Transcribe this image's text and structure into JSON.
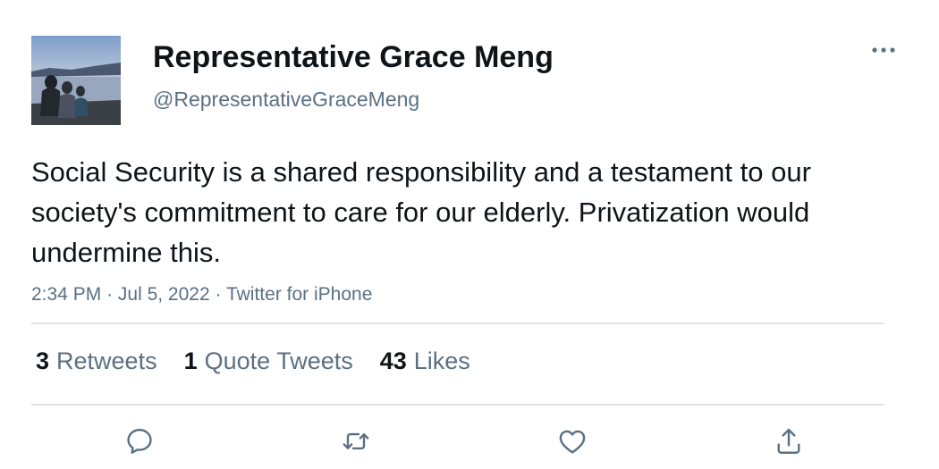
{
  "author": {
    "name": "Representative Grace Meng",
    "handle": "@RepresentativeGraceMeng"
  },
  "tweet": {
    "text": "Social Security is a shared responsibility and a testament to our society's commitment to care for our elderly. Privatization would undermine this.",
    "time": "2:34 PM",
    "date": "Jul 5, 2022",
    "source": "Twitter for iPhone",
    "separator": "·"
  },
  "stats": {
    "retweets": {
      "count": "3",
      "label": "Retweets"
    },
    "quotes": {
      "count": "1",
      "label": "Quote Tweets"
    },
    "likes": {
      "count": "43",
      "label": "Likes"
    }
  },
  "icons": {
    "more": "more-horizontal-icon",
    "reply": "reply-icon",
    "retweet": "retweet-icon",
    "like": "heart-icon",
    "share": "share-icon"
  },
  "colors": {
    "text_primary": "#0f1419",
    "text_secondary": "#5b7083",
    "divider": "#dfe3e6"
  }
}
